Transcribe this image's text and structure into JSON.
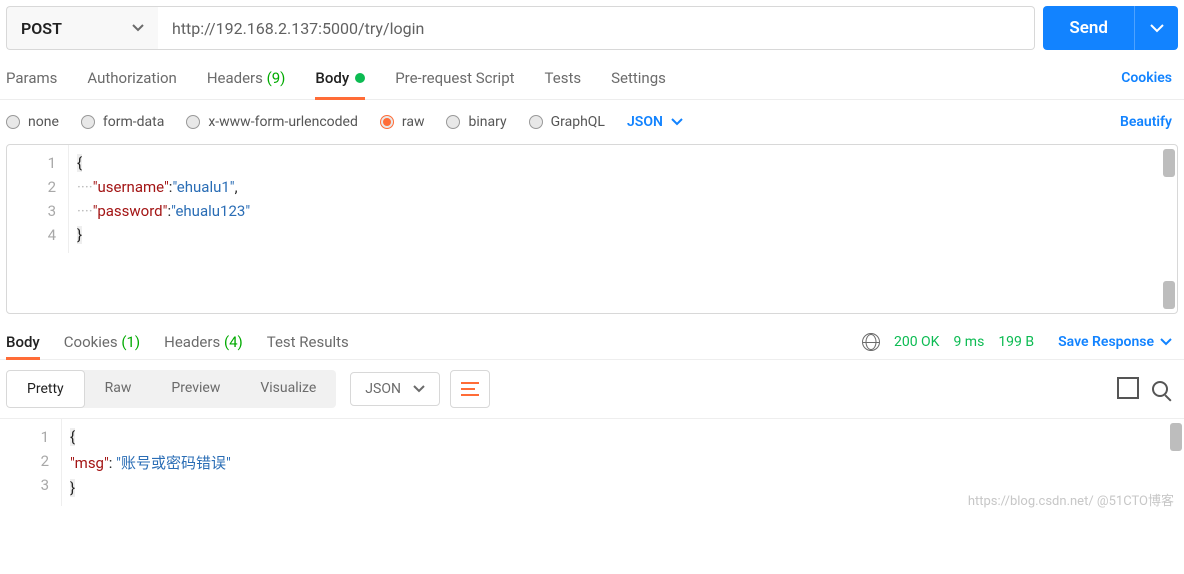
{
  "request": {
    "method": "POST",
    "url": "http://192.168.2.137:5000/try/login",
    "send_label": "Send"
  },
  "tabs": {
    "params": "Params",
    "auth": "Authorization",
    "headers": "Headers",
    "headers_count": "(9)",
    "body": "Body",
    "prerequest": "Pre-request Script",
    "tests": "Tests",
    "settings": "Settings",
    "cookies": "Cookies"
  },
  "body_types": {
    "none": "none",
    "formdata": "form-data",
    "urlencoded": "x-www-form-urlencoded",
    "raw": "raw",
    "binary": "binary",
    "graphql": "GraphQL",
    "language": "JSON",
    "beautify": "Beautify"
  },
  "request_body": {
    "lines": [
      "1",
      "2",
      "3",
      "4"
    ],
    "l1": "{",
    "l2_indent": "····",
    "l2_key": "\"username\"",
    "l2_sep": ":",
    "l2_val": "\"ehualu1\"",
    "l2_end": ",",
    "l3_indent": "····",
    "l3_key": "\"password\"",
    "l3_sep": ":",
    "l3_val": "\"ehualu123\"",
    "l4": "}"
  },
  "response_tabs": {
    "body": "Body",
    "cookies": "Cookies",
    "cookies_count": "(1)",
    "headers": "Headers",
    "headers_count": "(4)",
    "tests": "Test Results"
  },
  "status": {
    "code": "200 OK",
    "time": "9 ms",
    "size": "199 B",
    "save": "Save Response"
  },
  "view": {
    "pretty": "Pretty",
    "raw": "Raw",
    "preview": "Preview",
    "visualize": "Visualize",
    "lang": "JSON"
  },
  "response_body": {
    "lines": [
      "1",
      "2",
      "3"
    ],
    "l1": "{",
    "l2_indent": "    ",
    "l2_key": "\"msg\"",
    "l2_sep": ": ",
    "l2_val": "\"账号或密码错误\"",
    "l3": "}"
  },
  "watermark": "https://blog.csdn.net/   @51CTO博客"
}
